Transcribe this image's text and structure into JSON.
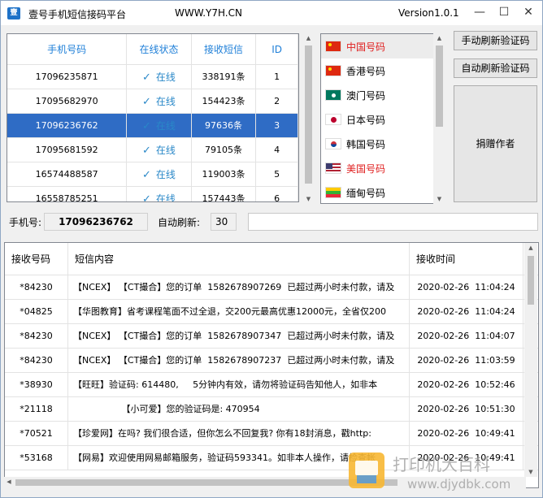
{
  "title": {
    "app_name": "壹号手机短信接码平台",
    "url": "WWW.Y7H.CN",
    "version": "Version1.0.1"
  },
  "window_controls": {
    "minimize": "—",
    "maximize": "☐",
    "close": "✕"
  },
  "numbers_table": {
    "headers": [
      "手机号码",
      "在线状态",
      "接收短信",
      "ID"
    ],
    "rows": [
      {
        "phone": "17096235871",
        "status": "在线",
        "count": "338191条",
        "id": "1"
      },
      {
        "phone": "17095682970",
        "status": "在线",
        "count": "154423条",
        "id": "2"
      },
      {
        "phone": "17096236762",
        "status": "在线",
        "count": "97636条",
        "id": "3"
      },
      {
        "phone": "17095681592",
        "status": "在线",
        "count": "79105条",
        "id": "4"
      },
      {
        "phone": "16574488587",
        "status": "在线",
        "count": "119003条",
        "id": "5"
      },
      {
        "phone": "16558785251",
        "status": "在线",
        "count": "157443条",
        "id": "6"
      }
    ],
    "selected_index": 2
  },
  "countries": [
    {
      "name": "中国号码",
      "flag": "flag-cn",
      "color": "#e02020"
    },
    {
      "name": "香港号码",
      "flag": "flag-hk",
      "color": "#000000"
    },
    {
      "name": "澳门号码",
      "flag": "flag-mo",
      "color": "#000000"
    },
    {
      "name": "日本号码",
      "flag": "flag-jp",
      "color": "#000000"
    },
    {
      "name": "韩国号码",
      "flag": "flag-kr",
      "color": "#000000"
    },
    {
      "name": "美国号码",
      "flag": "flag-us",
      "color": "#e02020"
    },
    {
      "name": "缅甸号码",
      "flag": "flag-mm",
      "color": "#000000"
    }
  ],
  "buttons": {
    "manual_refresh": "手动刷新验证码",
    "auto_refresh": "自动刷新验证码",
    "donate": "捐赠作者"
  },
  "phone_field": {
    "label": "手机号:",
    "value": "17096236762"
  },
  "auto_refresh_field": {
    "label": "自动刷新:",
    "value": "30"
  },
  "sms_table": {
    "headers": [
      "接收号码",
      "短信内容",
      "接收时间"
    ],
    "rows": [
      {
        "from": "*84230",
        "content": "【NCEX】 【CT撮合】您的订单  1582678907269  已超过两小时未付款，请及",
        "time": "2020-02-26  11:04:24"
      },
      {
        "from": "*04825",
        "content": "【华图教育】省考课程笔面不过全退，交200元最高优惠12000元，全省仅200",
        "time": "2020-02-26  11:04:24"
      },
      {
        "from": "*84230",
        "content": "【NCEX】 【CT撮合】您的订单  1582678907347  已超过两小时未付款，请及",
        "time": "2020-02-26  11:04:07"
      },
      {
        "from": "*84230",
        "content": "【NCEX】 【CT撮合】您的订单  1582678907237  已超过两小时未付款，请及",
        "time": "2020-02-26  11:03:59"
      },
      {
        "from": "*38930",
        "content": "【旺旺】验证码: 614480,     5分钟内有效，请勿将验证码告知他人，如非本",
        "time": "2020-02-26  10:52:46"
      },
      {
        "from": "*21118",
        "content": "                 【小可爱】您的验证码是: 470954",
        "time": "2020-02-26  10:51:30"
      },
      {
        "from": "*70521",
        "content": "【珍爱网】在吗? 我们很合适，但你怎么不回复我? 你有18封消息，戳http:",
        "time": "2020-02-26  10:49:41"
      },
      {
        "from": "*53168",
        "content": "【网易】欢迎使用网易邮箱服务，验证码593341。如非本人操作，请检查帐",
        "time": "2020-02-26  10:49:41"
      }
    ]
  },
  "watermark_text": "打印机大百科 www.djydbk.com"
}
